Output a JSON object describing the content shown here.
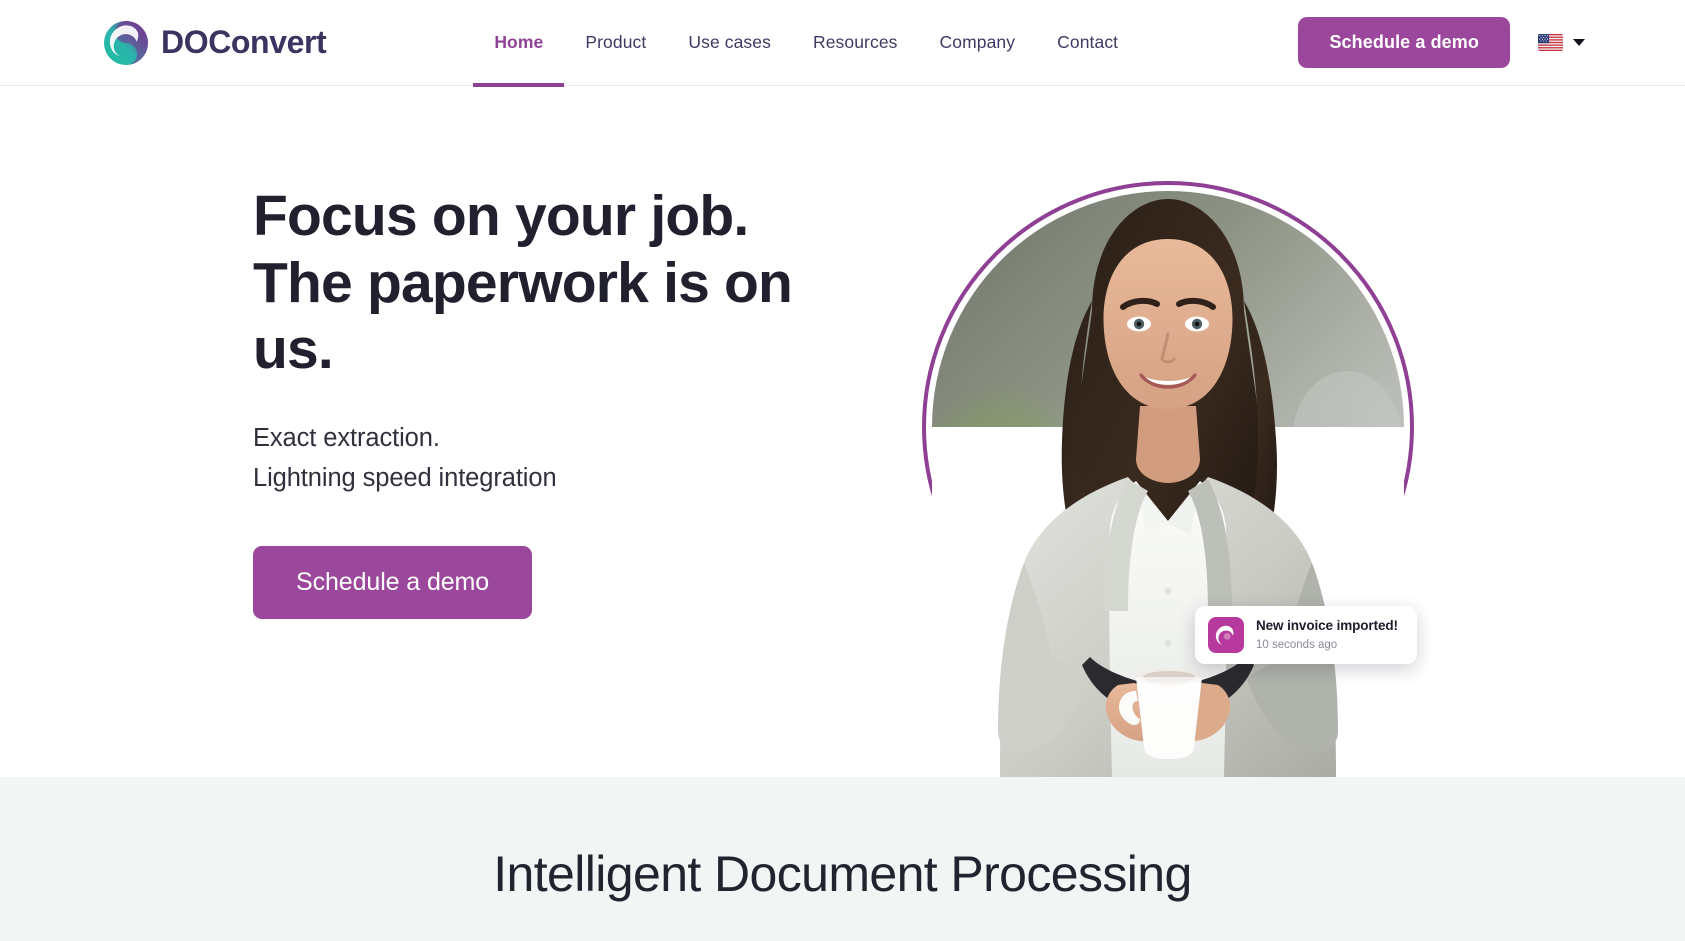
{
  "brand": {
    "name": "DOConvert",
    "logo_icon": "swirl-circle-logo",
    "wordmark_color": "#3b3360",
    "accent_purple": "#9b479c",
    "accent_magenta": "#b8399d",
    "gradient_teal": "#2ec4a6",
    "gradient_purple": "#7b2f8f"
  },
  "header": {
    "nav": [
      {
        "label": "Home",
        "active": true
      },
      {
        "label": "Product",
        "active": false
      },
      {
        "label": "Use cases",
        "active": false
      },
      {
        "label": "Resources",
        "active": false
      },
      {
        "label": "Company",
        "active": false
      },
      {
        "label": "Contact",
        "active": false
      }
    ],
    "cta_label": "Schedule a demo",
    "language": {
      "flag_icon": "us-flag-icon",
      "chevron_icon": "chevron-down-icon"
    }
  },
  "hero": {
    "title_line1": "Focus on your job.",
    "title_line2": "The paperwork is on",
    "title_line3": "us.",
    "sub_line1": "Exact extraction.",
    "sub_line2": "Lightning speed integration",
    "cta_label": "Schedule a demo",
    "image_alt": "smiling businesswoman holding a coffee mug",
    "ring_color": "#8f3f94",
    "toast": {
      "icon": "swirl-app-icon",
      "title": "New invoice imported!",
      "time": "10 seconds ago"
    }
  },
  "section_idp": {
    "heading": "Intelligent Document Processing",
    "background": "#f1f5f4"
  }
}
